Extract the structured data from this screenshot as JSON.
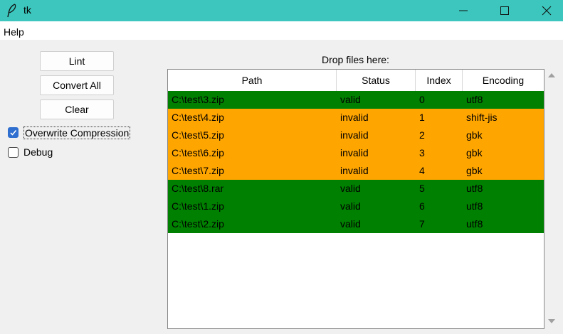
{
  "window": {
    "title": "tk"
  },
  "menu": {
    "items": [
      "Help"
    ]
  },
  "buttons": {
    "lint": "Lint",
    "convert_all": "Convert All",
    "clear": "Clear"
  },
  "options": [
    {
      "label": "Overwrite Compression",
      "checked": true
    },
    {
      "label": "Debug",
      "checked": false
    }
  ],
  "drop_label": "Drop files here:",
  "table": {
    "columns": [
      "Path",
      "Status",
      "Index",
      "Encoding"
    ],
    "rows": [
      {
        "path": "C:\\test\\3.zip",
        "status": "valid",
        "index": "0",
        "encoding": "utf8"
      },
      {
        "path": "C:\\test\\4.zip",
        "status": "invalid",
        "index": "1",
        "encoding": "shift-jis"
      },
      {
        "path": "C:\\test\\5.zip",
        "status": "invalid",
        "index": "2",
        "encoding": "gbk"
      },
      {
        "path": "C:\\test\\6.zip",
        "status": "invalid",
        "index": "3",
        "encoding": "gbk"
      },
      {
        "path": "C:\\test\\7.zip",
        "status": "invalid",
        "index": "4",
        "encoding": "gbk"
      },
      {
        "path": "C:\\test\\8.rar",
        "status": "valid",
        "index": "5",
        "encoding": "utf8"
      },
      {
        "path": "C:\\test\\1.zip",
        "status": "valid",
        "index": "6",
        "encoding": "utf8"
      },
      {
        "path": "C:\\test\\2.zip",
        "status": "valid",
        "index": "7",
        "encoding": "utf8"
      }
    ]
  },
  "colors": {
    "titlebar": "#3cc6bd",
    "valid_row": "#008000",
    "invalid_row": "#ffa500",
    "checkbox_checked": "#2f6fcf"
  },
  "icons": [
    "feather-icon",
    "minimize-icon",
    "maximize-icon",
    "close-icon",
    "check-icon",
    "scroll-up-arrow-icon",
    "scroll-down-arrow-icon"
  ]
}
